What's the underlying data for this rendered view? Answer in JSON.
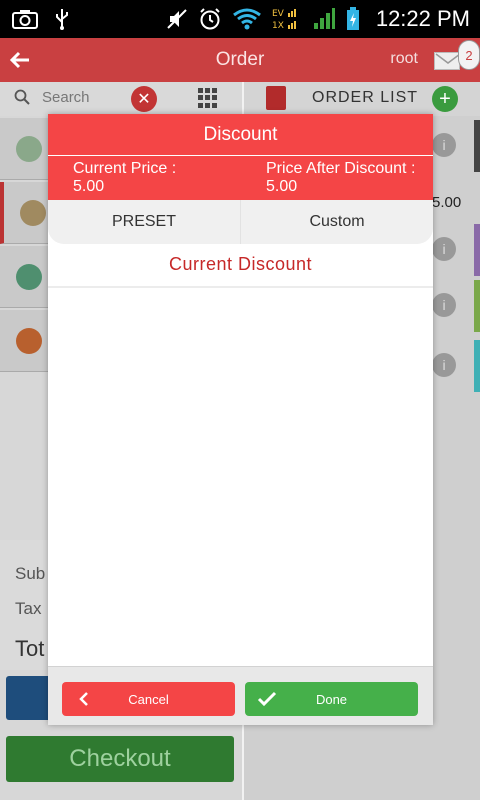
{
  "status_bar": {
    "time": "12:22 PM",
    "notification_count": "2"
  },
  "app_bar": {
    "title": "Order",
    "user": "root"
  },
  "search": {
    "placeholder": "Search"
  },
  "order_panel": {
    "title": "ORDER LIST",
    "visible_price_fragment": "5.00"
  },
  "totals": {
    "subtotal_fragment": "Sub",
    "tax_fragment": "Tax",
    "total_fragment": "Tot"
  },
  "checkout": {
    "label": "Checkout"
  },
  "dialog": {
    "title": "Discount",
    "current_price_label": "Current Price :",
    "current_price_value": "5.00",
    "after_discount_label": "Price After Discount :",
    "after_discount_value": "5.00",
    "tabs": [
      "PRESET",
      "Custom"
    ],
    "section_title": "Current Discount",
    "cancel_label": "Cancel",
    "done_label": "Done"
  },
  "colors": {
    "accent_red": "#f44546",
    "header_red": "#c94041",
    "done_green": "#45b04a"
  }
}
